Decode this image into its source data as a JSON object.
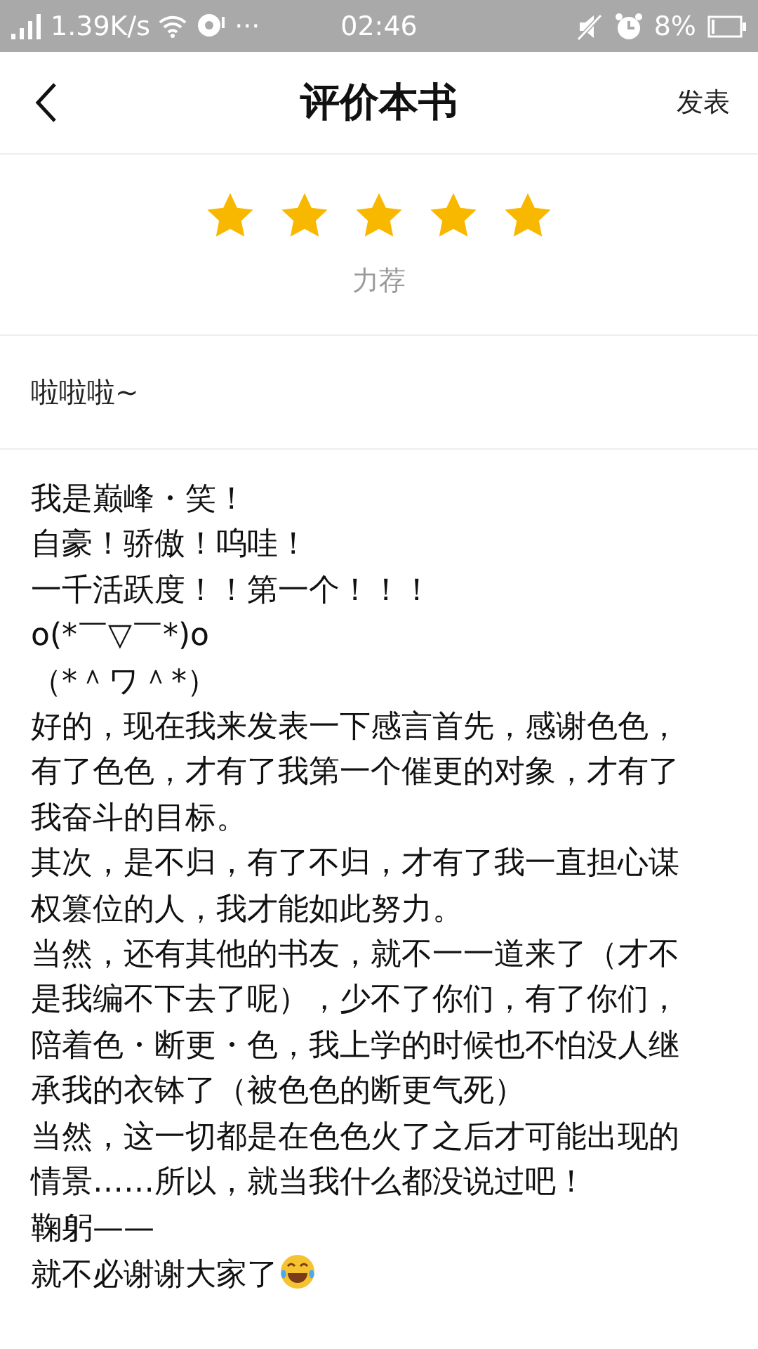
{
  "status_bar": {
    "speed": "1.39K/s",
    "more": "···",
    "time": "02:46",
    "battery": "8%"
  },
  "header": {
    "title": "评价本书",
    "action": "发表"
  },
  "rating": {
    "stars": 5,
    "label": "力荐"
  },
  "review_title": {
    "value": "啦啦啦~"
  },
  "review_body": {
    "paragraphs": [
      "我是巅峰・笑！",
      "自豪！骄傲！呜哇！",
      "一千活跃度！！第一个！！！",
      "o(*￣▽￣*)o",
      "（*＾ワ＾*）",
      "好的，现在我来发表一下感言首先，感谢色色，有了色色，才有了我第一个催更的对象，才有了我奋斗的目标。",
      "其次，是不归，有了不归，才有了我一直担心谋权篡位的人，我才能如此努力。",
      "当然，还有其他的书友，就不一一道来了（才不是我编不下去了呢），少不了你们，有了你们，陪着色・断更・色，我上学的时候也不怕没人继承我的衣钵了（被色色的断更气死）",
      "当然，这一切都是在色色火了之后才可能出现的情景……所以，就当我什么都没说过吧！",
      "鞠躬——",
      "就不必谢谢大家了"
    ],
    "emoji": true
  }
}
